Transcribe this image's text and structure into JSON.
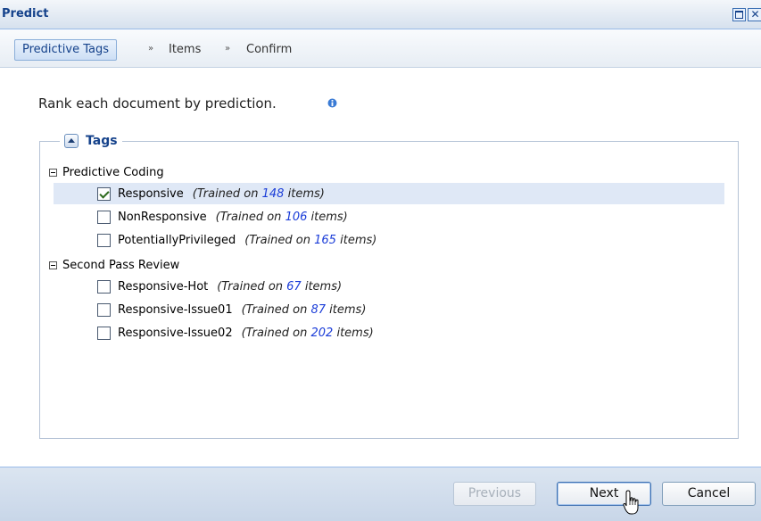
{
  "window": {
    "title": "Predict",
    "close_glyph": "✕"
  },
  "wizard": {
    "steps": [
      "Predictive Tags",
      "Items",
      "Confirm"
    ],
    "separator": "»",
    "active_step": "Predictive Tags"
  },
  "prompt": "Rank each document by prediction.",
  "tags": {
    "legend": "Tags",
    "groups": [
      {
        "label": "Predictive Coding",
        "items": [
          {
            "name": "Responsive",
            "count": "148",
            "checked": true,
            "selected": true
          },
          {
            "name": "NonResponsive",
            "count": "106",
            "checked": false,
            "selected": false
          },
          {
            "name": "PotentiallyPrivileged",
            "count": "165",
            "checked": false,
            "selected": false
          }
        ]
      },
      {
        "label": "Second Pass Review",
        "items": [
          {
            "name": "Responsive-Hot",
            "count": "67",
            "checked": false,
            "selected": false
          },
          {
            "name": "Responsive-Issue01",
            "count": "87",
            "checked": false,
            "selected": false
          },
          {
            "name": "Responsive-Issue02",
            "count": "202",
            "checked": false,
            "selected": false
          }
        ]
      }
    ],
    "trained_prefix": "(Trained on",
    "trained_suffix": "items)"
  },
  "footer": {
    "previous_label": "Previous",
    "next_label": "Next",
    "cancel_label": "Cancel"
  },
  "icons": [
    "maximize-icon",
    "close-icon",
    "info-icon",
    "collapse-icon",
    "minus-icon",
    "checkmark-icon",
    "hand-cursor-icon"
  ],
  "colors": {
    "title": "#15428b",
    "count": "#1a3cd8",
    "selected_row": "#dfe8f6"
  }
}
